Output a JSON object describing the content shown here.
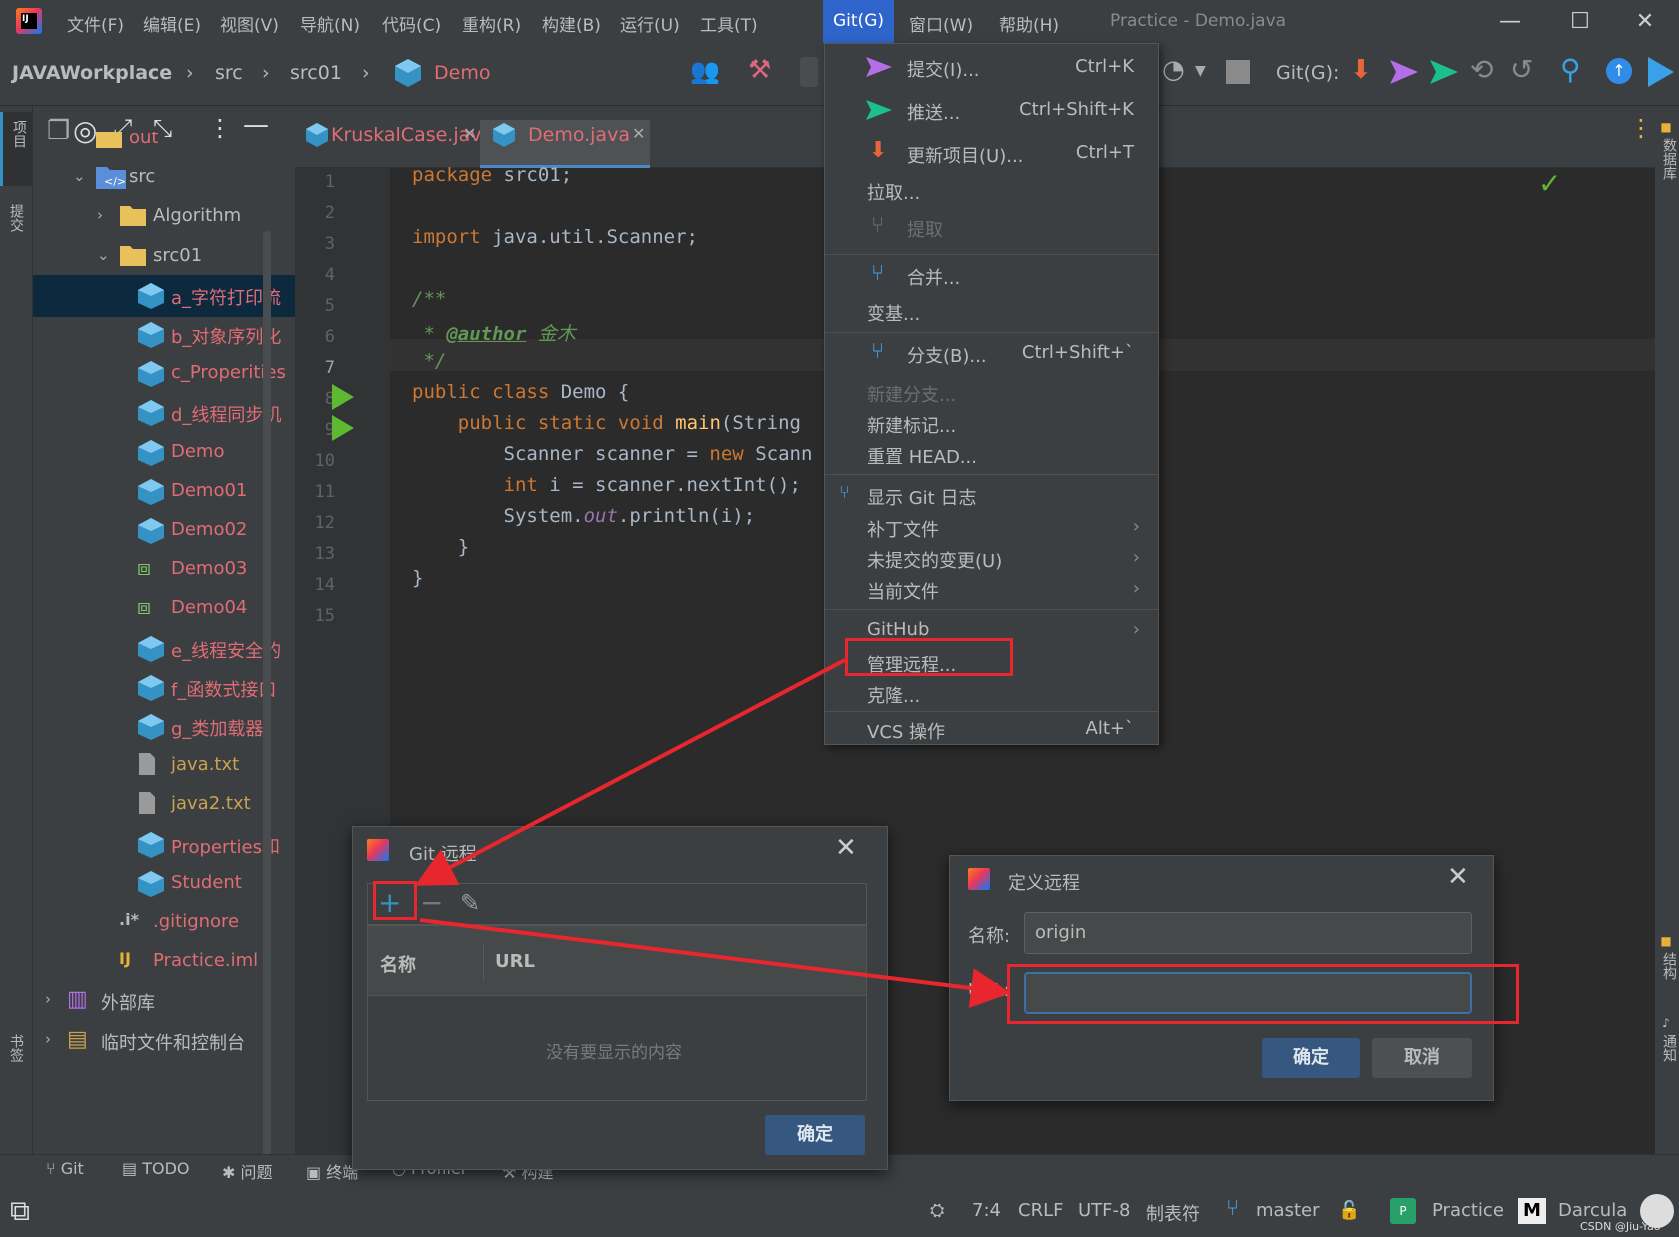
{
  "colors": {
    "accent": "#2f65ca",
    "highlight": "#e8262d",
    "editor_bg": "#2b2b2b",
    "panel_bg": "#3c3f41"
  },
  "menubar": {
    "items": [
      "文件(F)",
      "编辑(E)",
      "视图(V)",
      "导航(N)",
      "代码(C)",
      "重构(R)",
      "构建(B)",
      "运行(U)",
      "工具(T)",
      "Git(G)",
      "窗口(W)",
      "帮助(H)"
    ],
    "window_title": "Practice - Demo.java"
  },
  "navbar": {
    "project": "JAVAWorkplace",
    "crumb1": "src",
    "crumb2": "src01",
    "crumb3": "Demo",
    "git_label": "Git(G):"
  },
  "left_strip": {
    "project": "项目",
    "commit": "提交",
    "bookmarks": "书签"
  },
  "right_strip": {
    "database": "数据库",
    "structure": "结构",
    "notifications": "通知"
  },
  "project_tree": {
    "rows": [
      {
        "label": "out",
        "cls": "red",
        "indent": 1
      },
      {
        "label": "src",
        "cls": "",
        "indent": 1
      },
      {
        "label": "Algorithm",
        "cls": "",
        "indent": 2
      },
      {
        "label": "src01",
        "cls": "",
        "indent": 2
      },
      {
        "label": "a_字符打印流",
        "cls": "red",
        "indent": 3
      },
      {
        "label": "b_对象序列化",
        "cls": "red",
        "indent": 3
      },
      {
        "label": "c_Properities",
        "cls": "red",
        "indent": 3
      },
      {
        "label": "d_线程同步机",
        "cls": "red",
        "indent": 3
      },
      {
        "label": "Demo",
        "cls": "red",
        "indent": 3
      },
      {
        "label": "Demo01",
        "cls": "red",
        "indent": 3
      },
      {
        "label": "Demo02",
        "cls": "red",
        "indent": 3
      },
      {
        "label": "Demo03",
        "cls": "red",
        "indent": 3
      },
      {
        "label": "Demo04",
        "cls": "red",
        "indent": 3
      },
      {
        "label": "e_线程安全的",
        "cls": "red",
        "indent": 3
      },
      {
        "label": "f_函数式接口",
        "cls": "red",
        "indent": 3
      },
      {
        "label": "g_类加载器",
        "cls": "red",
        "indent": 3
      },
      {
        "label": "java.txt",
        "cls": "yel",
        "indent": 3
      },
      {
        "label": "java2.txt",
        "cls": "yel",
        "indent": 3
      },
      {
        "label": "Properties和",
        "cls": "red",
        "indent": 3
      },
      {
        "label": "Student",
        "cls": "red",
        "indent": 3
      },
      {
        "label": ".gitignore",
        "cls": "red",
        "indent": 2
      },
      {
        "label": "Practice.iml",
        "cls": "red",
        "indent": 2
      },
      {
        "label": "外部库",
        "cls": "",
        "indent": 0
      },
      {
        "label": "临时文件和控制台",
        "cls": "",
        "indent": 0
      }
    ]
  },
  "tabs": [
    {
      "label": "KruskalCase.java"
    },
    {
      "label": "Demo.java"
    }
  ],
  "editor": {
    "line_numbers": [
      "1",
      "2",
      "3",
      "4",
      "5",
      "6",
      "7",
      "8",
      "9",
      "10",
      "11",
      "12",
      "13",
      "14",
      "15"
    ]
  },
  "git_menu": {
    "commit": "提交(I)...",
    "commit_sc": "Ctrl+K",
    "push": "推送...",
    "push_sc": "Ctrl+Shift+K",
    "update": "更新项目(U)...",
    "update_sc": "Ctrl+T",
    "pull": "拉取...",
    "fetch": "提取",
    "merge": "合并...",
    "rebase": "变基...",
    "branches": "分支(B)...",
    "branches_sc": "Ctrl+Shift+`",
    "new_branch": "新建分支...",
    "new_tag": "新建标记...",
    "reset_head": "重置 HEAD...",
    "show_log": "显示 Git 日志",
    "patch": "补丁文件",
    "uncommitted": "未提交的变更(U)",
    "current_file": "当前文件",
    "github": "GitHub",
    "manage_remotes": "管理远程...",
    "clone": "克隆...",
    "vcs_ops": "VCS 操作",
    "vcs_ops_sc": "Alt+`"
  },
  "git_remotes_dialog": {
    "title": "Git 远程",
    "col_name": "名称",
    "col_url": "URL",
    "empty": "没有要显示的内容",
    "ok": "确定"
  },
  "define_remote_dialog": {
    "title": "定义远程",
    "name_label": "名称:",
    "name_value": "origin",
    "url_label": "URL:",
    "url_value": "",
    "ok": "确定",
    "cancel": "取消"
  },
  "toolwindows": {
    "git": "Git",
    "todo": "TODO",
    "problems": "问题",
    "terminal": "终端",
    "profiler": "Profiler",
    "build": "构建"
  },
  "status": {
    "position": "7:4",
    "line_sep": "CRLF",
    "encoding": "UTF-8",
    "indent": "制表符",
    "branch": "master",
    "project": "Practice",
    "theme": "Darcula",
    "watermark": "CSDN @Jiu-Yao"
  }
}
